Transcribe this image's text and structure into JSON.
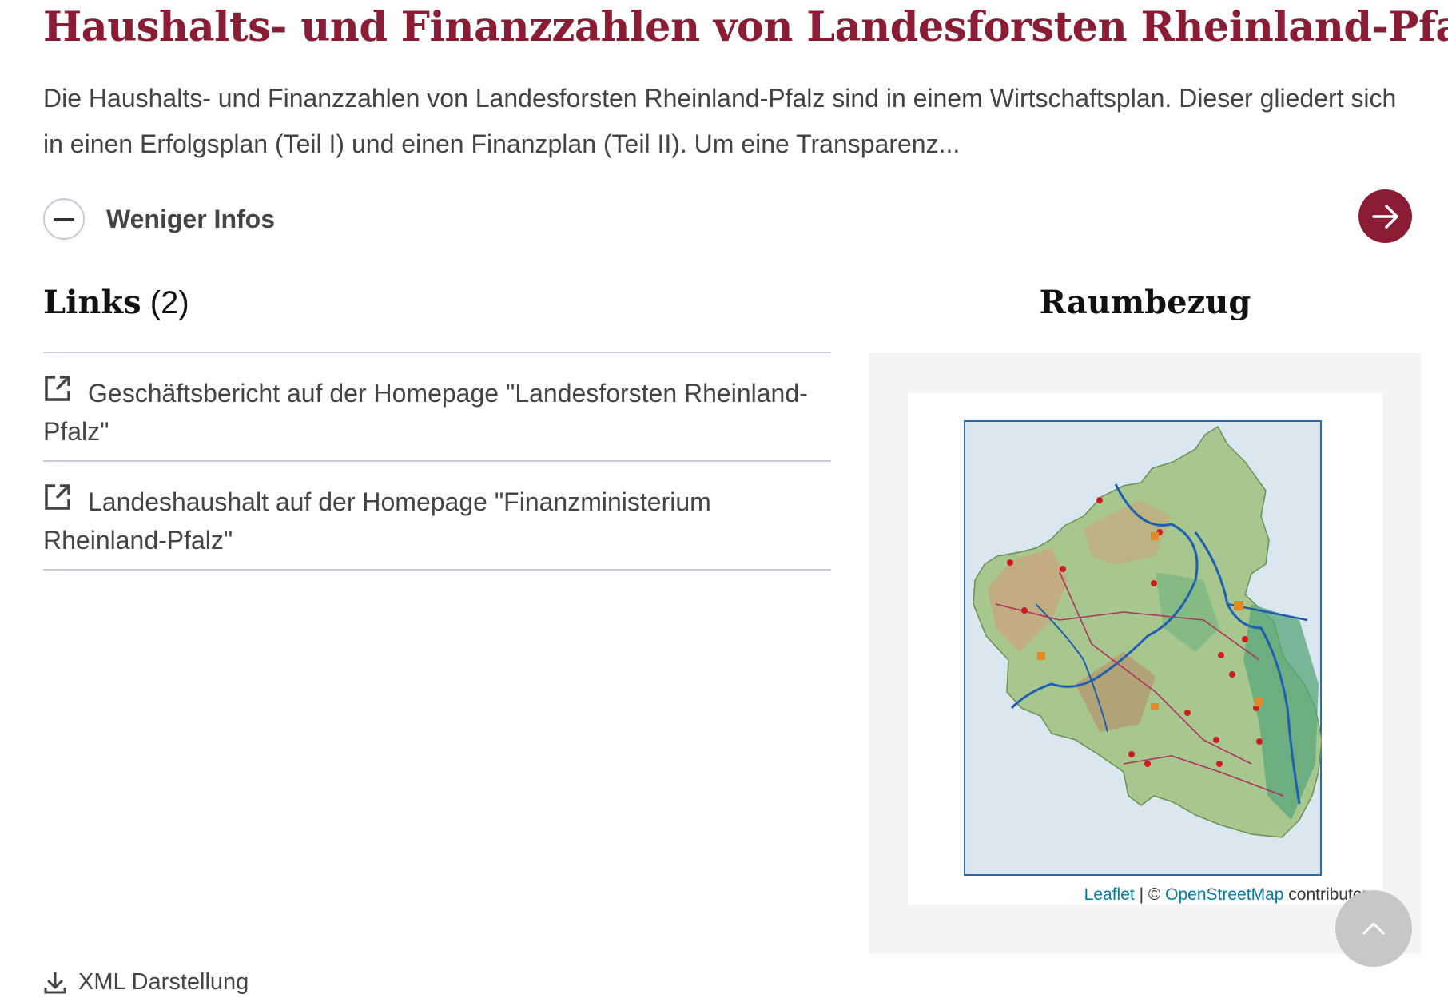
{
  "page": {
    "title": "Haushalts- und Finanzzahlen von Landesforsten Rheinland-Pfalz",
    "description": "Die Haushalts- und Finanzzahlen von Landesforsten Rheinland-Pfalz sind in einem Wirtschaftsplan. Dieser gliedert sich in einen Erfolgsplan (Teil I) und einen Finanzplan (Teil II). Um eine Transparenz..."
  },
  "toggle": {
    "label": "Weniger Infos",
    "icon": "minus-icon"
  },
  "open_button": {
    "icon": "arrow-right-icon"
  },
  "links": {
    "heading": "Links",
    "count": "(2)",
    "items": [
      {
        "label": "Geschäftsbericht auf der Homepage \"Landesforsten Rheinland-Pfalz\"",
        "icon": "external-link-icon"
      },
      {
        "label": "Landeshaushalt auf der Homepage \"Finanzministerium Rheinland-Pfalz\"",
        "icon": "external-link-icon"
      }
    ]
  },
  "raumbezug": {
    "heading": "Raumbezug",
    "map": {
      "attribution_leaflet": "Leaflet",
      "attribution_separator": "| ©",
      "attribution_osm": "OpenStreetMap",
      "attribution_suffix": "contributors"
    }
  },
  "footer": {
    "xml_label": "XML Darstellung",
    "icon": "download-icon"
  },
  "scroll_top": {
    "icon": "chevron-up-icon"
  },
  "colors": {
    "accent": "#8a1c34",
    "divider": "#c9ccd8",
    "link_blue": "#0078a8"
  }
}
